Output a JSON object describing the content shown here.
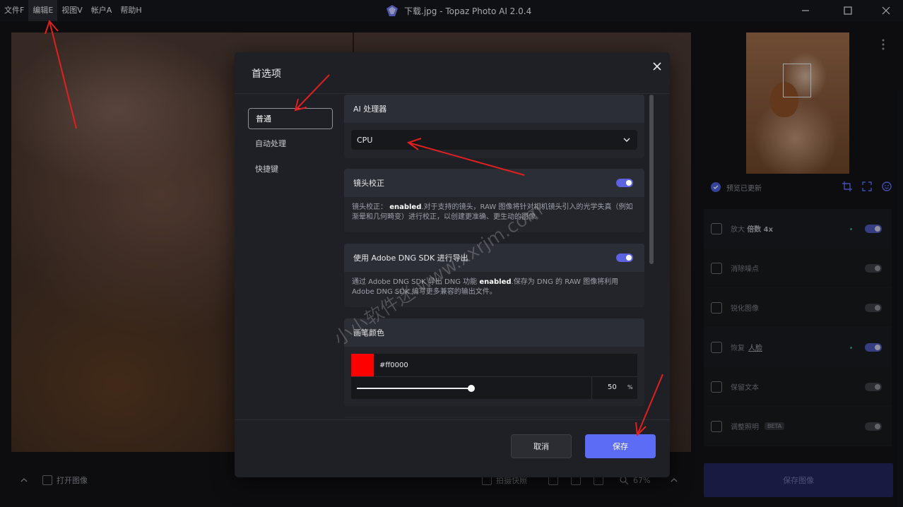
{
  "menu": {
    "items": [
      {
        "label": "文件F"
      },
      {
        "label": "编辑E"
      },
      {
        "label": "视图V"
      },
      {
        "label": "帐户A"
      },
      {
        "label": "帮助H"
      }
    ]
  },
  "window": {
    "title": "下载.jpg - Topaz Photo AI 2.0.4"
  },
  "bottom_bar": {
    "open_image": "打开图像",
    "snapshot": "拍摄快照",
    "zoom": "67%"
  },
  "right_panel": {
    "preview_status": "预览已更新",
    "tools": [
      {
        "label": "放大",
        "value": "倍数 4x",
        "enabled": true
      },
      {
        "label": "消除噪点",
        "enabled": false
      },
      {
        "label": "锐化图像",
        "enabled": false
      },
      {
        "label": "恢复",
        "sub": "人脸",
        "enabled": true
      },
      {
        "label": "保留文本",
        "enabled": false
      },
      {
        "label": "调整照明",
        "badge": "BETA",
        "enabled": false
      }
    ],
    "save_image": "保存图像"
  },
  "dialog": {
    "title": "首选项",
    "nav": [
      {
        "label": "普通"
      },
      {
        "label": "自动处理"
      },
      {
        "label": "快捷键"
      }
    ],
    "ai_processor": {
      "heading": "AI 处理器",
      "selected": "CPU"
    },
    "lens_correction": {
      "heading": "镜头校正",
      "enabled": true,
      "desc_prefix": "镜头校正：",
      "desc_state": "enabled",
      "desc_rest": ".对于支持的镜头，RAW 图像将针对相机镜头引入的光学失真（例如渐晕和几何畸变）进行校正，以创建更准确、更生动的图像。"
    },
    "dng_sdk": {
      "heading": "使用 Adobe DNG SDK 进行导出",
      "enabled": true,
      "desc_prefix": "通过 Adobe DNG SDK 导出 DNG 功能 ",
      "desc_state": "enabled",
      "desc_rest": ".保存为 DNG 的 RAW 图像将利用 Adobe DNG SDK 编写更多兼容的输出文件。"
    },
    "brush_color": {
      "heading": "画笔颜色",
      "hex": "#ff0000",
      "swatch": "#ff0000",
      "opacity": "50",
      "unit": "%",
      "opacity_fraction": 0.5
    },
    "cancel": "取消",
    "save": "保存"
  },
  "watermark": {
    "text": "小小软件迷 www.xxrjm.com"
  },
  "colors": {
    "accent": "#5c6cf5",
    "annotation": "#e02020"
  }
}
